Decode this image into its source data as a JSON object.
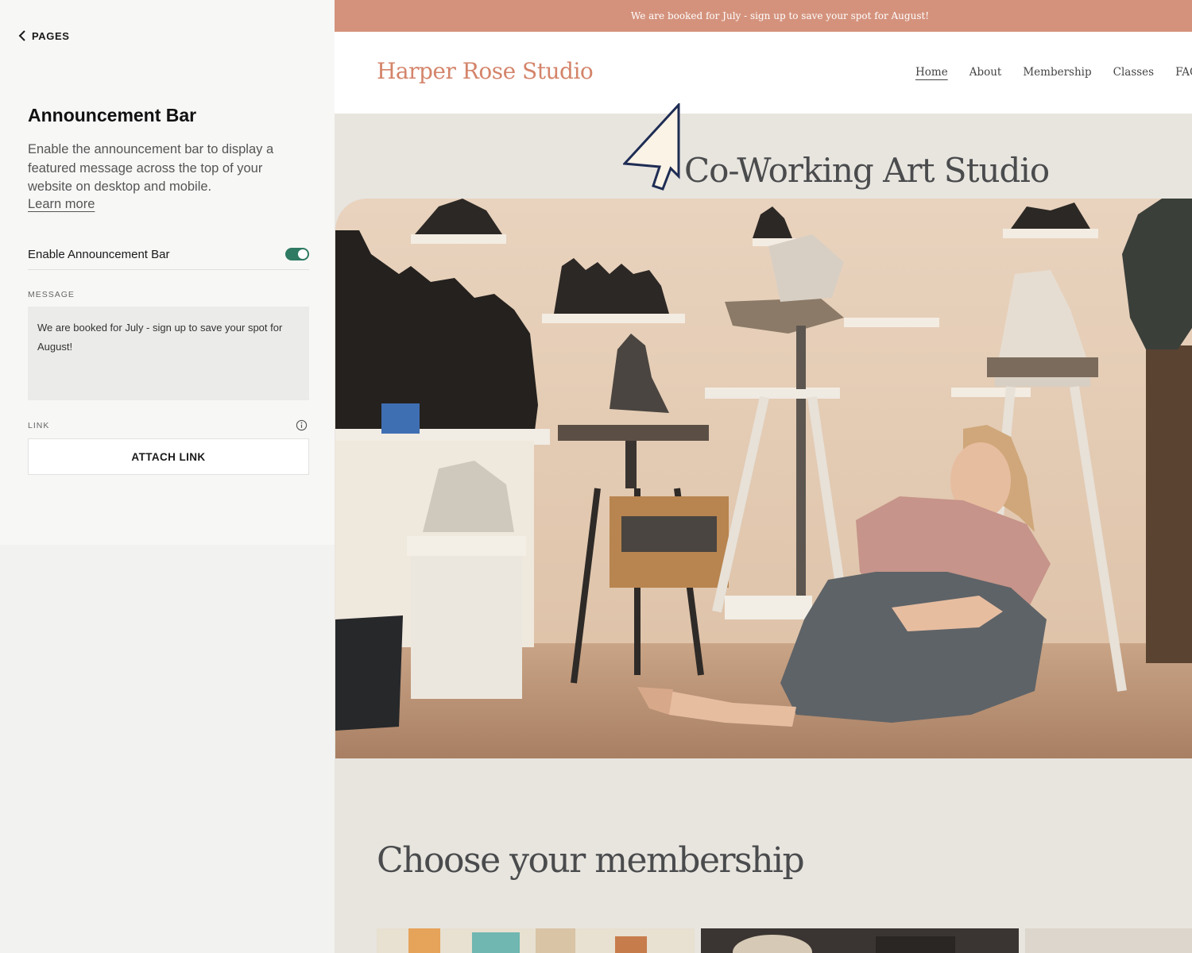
{
  "editor": {
    "back_label": "PAGES",
    "title": "Announcement Bar",
    "description": "Enable the announcement bar to display a featured message across the top of your website on desktop and mobile.",
    "learn_more": "Learn more",
    "toggle_label": "Enable Announcement Bar",
    "toggle_on": true,
    "message_label": "MESSAGE",
    "message_value": "We are booked for July - sign up to save your spot for August!",
    "link_label": "LINK",
    "attach_link": "ATTACH LINK"
  },
  "site": {
    "announcement": "We are booked for July - sign up to save your spot for August!",
    "logo": "Harper Rose Studio",
    "nav": [
      "Home",
      "About",
      "Membership",
      "Classes",
      "FAQs"
    ],
    "hero_title": "Co-Working Art Studio",
    "section_title": "Choose your membership"
  },
  "colors": {
    "accent": "#d4927c",
    "toggle": "#2f7a62",
    "logo": "#d4846a"
  }
}
